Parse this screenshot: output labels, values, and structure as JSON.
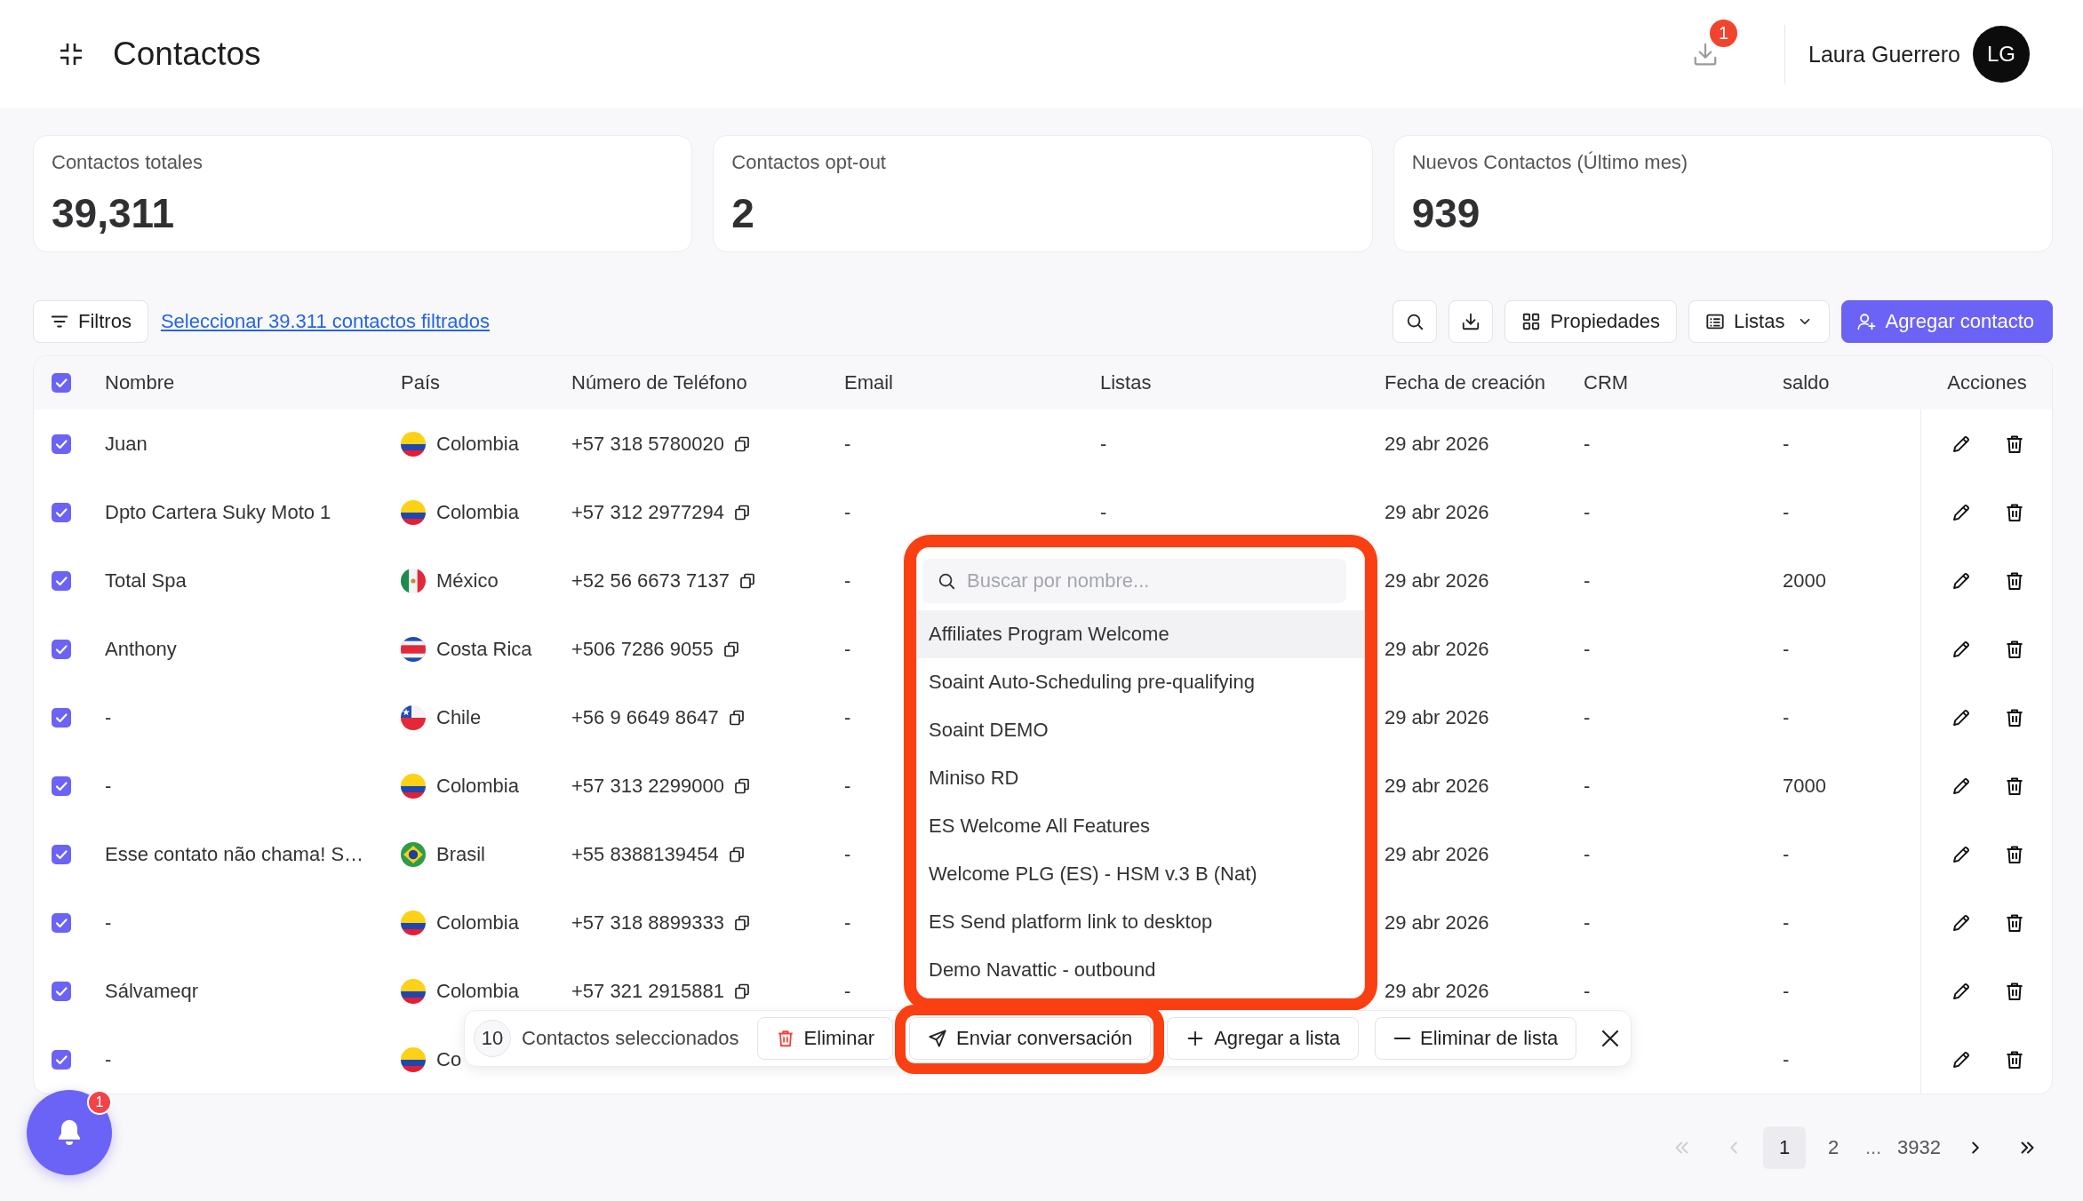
{
  "header": {
    "title": "Contactos",
    "downloads_badge": "1",
    "user_name": "Laura Guerrero",
    "avatar_initials": "LG"
  },
  "stats": [
    {
      "label": "Contactos totales",
      "value": "39,311"
    },
    {
      "label": "Contactos opt-out",
      "value": "2"
    },
    {
      "label": "Nuevos Contactos (Último mes)",
      "value": "939"
    }
  ],
  "toolbar": {
    "filter_button": "Filtros",
    "select_all_link": "Seleccionar 39.311 contactos filtrados",
    "properties_button": "Propiedades",
    "lists_button": "Listas",
    "add_button": "Agregar contacto"
  },
  "table": {
    "select_all": true,
    "columns": [
      "Nombre",
      "País",
      "Número de Teléfono",
      "Email",
      "Listas",
      "Fecha de creación",
      "CRM",
      "saldo",
      "Acciones"
    ],
    "rows": [
      {
        "selected": true,
        "name": "Juan",
        "flag": {
          "kind": "co"
        },
        "country": "Colombia",
        "phone": "+57 318 5780020",
        "email": "-",
        "lists": "-",
        "created": "29 abr 2026",
        "crm": "-",
        "balance": "-"
      },
      {
        "selected": true,
        "name": "Dpto Cartera Suky Moto 1",
        "flag": {
          "kind": "co"
        },
        "country": "Colombia",
        "phone": "+57 312 2977294",
        "email": "-",
        "lists": "-",
        "created": "29 abr 2026",
        "crm": "-",
        "balance": "-"
      },
      {
        "selected": true,
        "name": "Total Spa",
        "flag": {
          "kind": "mx"
        },
        "country": "México",
        "phone": "+52 56 6673 7137",
        "email": "-",
        "created": "29 abr 2026",
        "crm": "-",
        "balance": "2000"
      },
      {
        "selected": true,
        "name": "Anthony",
        "flag": {
          "kind": "cr"
        },
        "country": "Costa Rica",
        "phone": "+506 7286 9055",
        "email": "-",
        "created": "29 abr 2026",
        "crm": "-",
        "balance": "-"
      },
      {
        "selected": true,
        "name": "-",
        "flag": {
          "kind": "cl"
        },
        "country": "Chile",
        "phone": "+56 9 6649 8647",
        "email": "-",
        "created": "29 abr 2026",
        "crm": "-",
        "balance": "-"
      },
      {
        "selected": true,
        "name": "-",
        "flag": {
          "kind": "co"
        },
        "country": "Colombia",
        "phone": "+57 313 2299000",
        "email": "-",
        "created": "29 abr 2026",
        "crm": "-",
        "balance": "7000"
      },
      {
        "selected": true,
        "name": "Esse contato não chama! S…",
        "flag": {
          "kind": "br"
        },
        "country": "Brasil",
        "phone": "+55 8388139454",
        "email": "-",
        "created": "29 abr 2026",
        "crm": "-",
        "balance": "-"
      },
      {
        "selected": true,
        "name": "-",
        "flag": {
          "kind": "co"
        },
        "country": "Colombia",
        "phone": "+57 318 8899333",
        "email": "-",
        "created": "29 abr 2026",
        "crm": "-",
        "balance": "-"
      },
      {
        "selected": true,
        "name": "Sálvameqr",
        "flag": {
          "kind": "co"
        },
        "country": "Colombia",
        "phone": "+57 321 2915881",
        "email": "-",
        "created": "29 abr 2026",
        "crm": "-",
        "balance": "-"
      },
      {
        "selected": true,
        "name": "-",
        "flag": {
          "kind": "co"
        },
        "country": "Co",
        "balance": "-"
      }
    ]
  },
  "list_dropdown": {
    "outlined": true,
    "search": {
      "placeholder": "Buscar por nombre..."
    },
    "items": [
      {
        "label": "Affiliates Program Welcome",
        "highlighted": true
      },
      {
        "label": "Soaint Auto-Scheduling pre-qualifying",
        "highlighted": false
      },
      {
        "label": "Soaint DEMO",
        "highlighted": false
      },
      {
        "label": "Miniso RD",
        "highlighted": false
      },
      {
        "label": "ES Welcome All Features",
        "highlighted": false
      },
      {
        "label": "Welcome PLG (ES) - HSM v.3 B (Nat)",
        "highlighted": false
      },
      {
        "label": "ES Send platform link to desktop",
        "highlighted": false
      },
      {
        "label": "Demo Navattic - outbound",
        "highlighted": false
      }
    ]
  },
  "bulk_bar": {
    "count": "10",
    "label": "Contactos seleccionados",
    "actions": [
      {
        "kind": "delete",
        "label": "Eliminar",
        "outlined": false
      },
      {
        "kind": "send",
        "label": "Enviar conversación",
        "outlined": true
      },
      {
        "kind": "add",
        "label": "Agregar a lista",
        "outlined": false
      },
      {
        "kind": "remove",
        "label": "Eliminar de lista",
        "outlined": false
      }
    ]
  },
  "notifications": {
    "badge": "1"
  },
  "pagination": {
    "back": [
      {
        "kind": "first",
        "disabled": true
      },
      {
        "kind": "previous",
        "disabled": true
      }
    ],
    "pages": [
      {
        "kind": "page",
        "label": "1",
        "selected": true
      },
      {
        "kind": "page",
        "label": "2",
        "selected": false
      },
      {
        "kind": "gap",
        "label": "...",
        "selected": false
      },
      {
        "kind": "page",
        "label": "3932",
        "selected": false
      }
    ],
    "forward": [
      {
        "kind": "next",
        "disabled": false
      },
      {
        "kind": "last",
        "disabled": false
      }
    ]
  }
}
